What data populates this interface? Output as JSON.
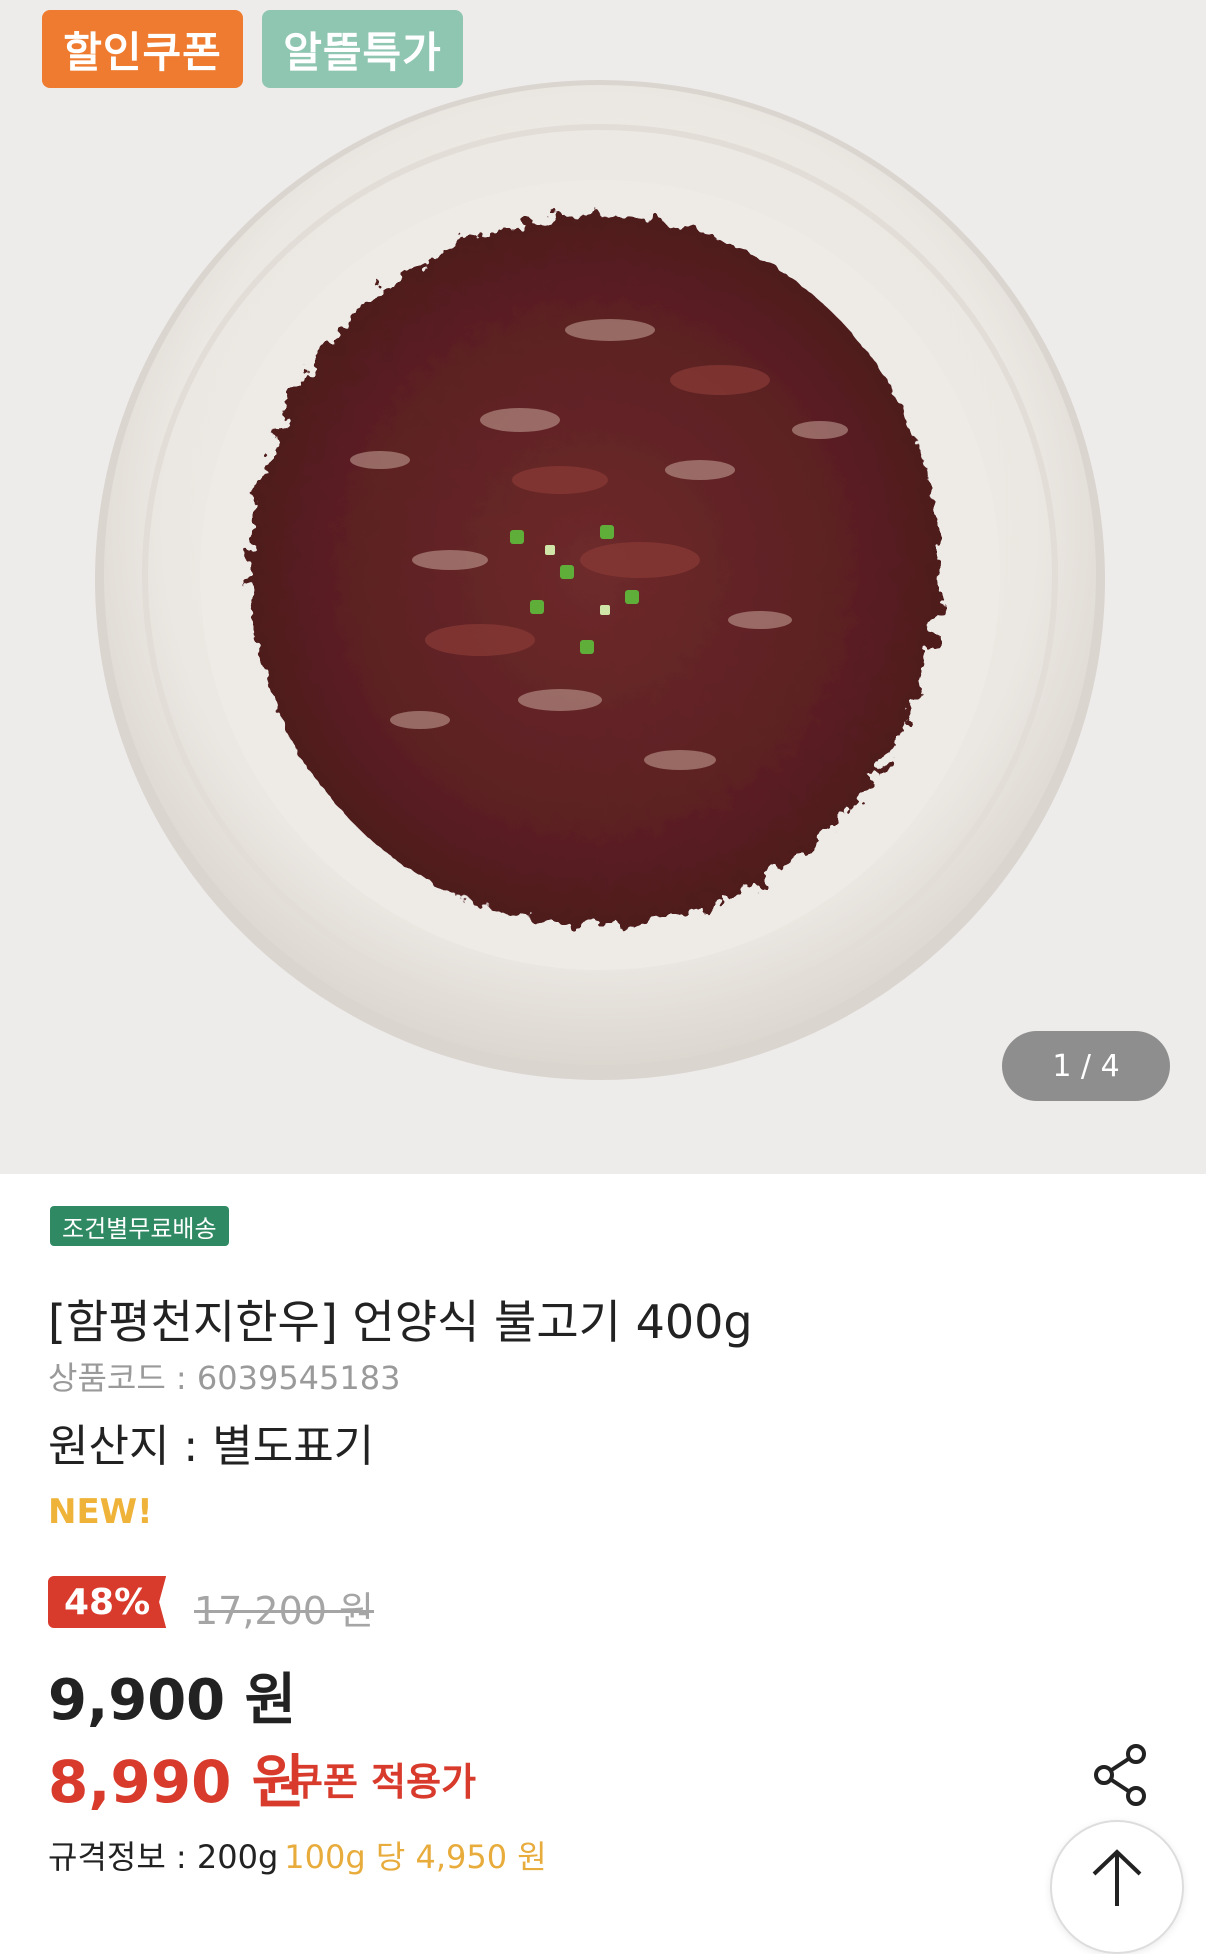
{
  "badges": {
    "coupon": "할인쿠폰",
    "deal": "알뜰특가"
  },
  "gallery": {
    "pager": "1 / 4",
    "image": "marinated bulgogi beef on a white ceramic plate topped with chopped green onion"
  },
  "product": {
    "shipping_tag": "조건별무료배송",
    "title": "[함평천지한우] 언양식 불고기 400g",
    "code": "상품코드 : 6039545183",
    "origin": "원산지 : 별도표기",
    "new_label": "NEW!",
    "discount": "48%",
    "original_price": "17,200 원",
    "price": "9,900 원",
    "coupon_price": "8,990 원",
    "coupon_label": "쿠폰 적용가",
    "spec_label": "규격정보 : 200g",
    "spec_unit": "100g 당  4,950 원"
  },
  "icons": {
    "share": "share-icon",
    "scroll_top": "arrow-up-icon"
  },
  "colors": {
    "coupon_badge": "#ee7b2f",
    "deal_badge": "#8fc6b2",
    "shipping_tag": "#2f8a63",
    "sale_red": "#d83a2c",
    "new_yellow": "#efb33a"
  }
}
